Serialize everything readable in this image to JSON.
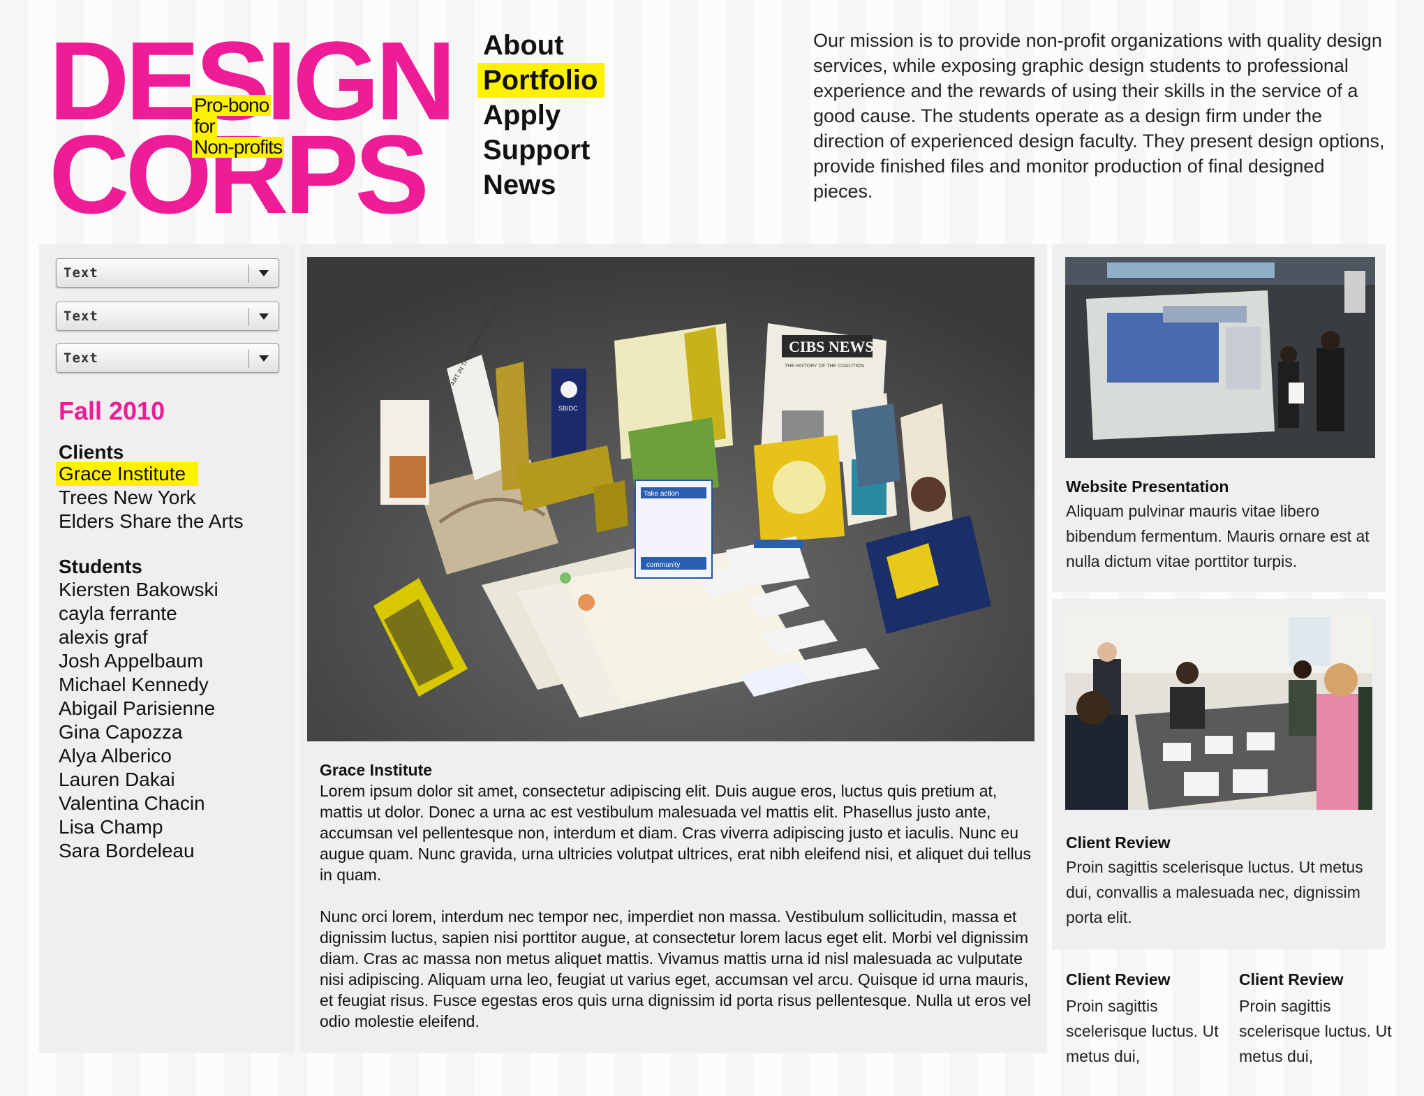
{
  "logo": {
    "line1": "DESIGN",
    "line2": "CORPS",
    "tag_line1": "Pro-bono",
    "tag_line2": "for",
    "tag_line3": "Non-profits"
  },
  "nav": {
    "items": [
      "About",
      "Portfolio",
      "Apply",
      "Support",
      "News"
    ],
    "active": "Portfolio"
  },
  "mission": "Our mission is to provide non-profit organizations with quality design services, while exposing graphic design students to professional experience and the rewards of using their skills in the service of a good cause. The students operate as a design firm under the direction of experienced design faculty. They present design options, provide finished files and monitor production of final designed pieces.",
  "filters": [
    "Text",
    "Text",
    "Text"
  ],
  "sidebar": {
    "term": "Fall 2010",
    "clients_heading": "Clients",
    "clients": [
      "Grace Institute",
      "Trees New York",
      "Elders Share the Arts"
    ],
    "active_client": "Grace Institute",
    "students_heading": "Students",
    "students": [
      "Kiersten Bakowski",
      "cayla ferrante",
      "alexis graf",
      "Josh Appelbaum",
      "Michael Kennedy",
      "Abigail Parisienne",
      "Gina Capozza",
      "Alya Alberico",
      "Lauren Dakai",
      "Valentina Chacin",
      "Lisa Champ",
      "Sara Bordeleau"
    ]
  },
  "feature": {
    "title": "Grace Institute",
    "paragraph1": "Lorem ipsum dolor sit amet, consectetur adipiscing elit. Duis augue eros, luctus quis pretium at, mattis ut dolor. Donec a urna ac est vestibulum malesuada vel mattis elit. Phasellus justo ante, accumsan vel pellentesque non, interdum et diam. Cras viverra adipiscing justo et iaculis. Nunc eu augue quam. Nunc gravida, urna ultricies volutpat ultrices, erat nibh eleifend nisi, et aliquet dui tellus in quam.",
    "paragraph2": "Nunc orci lorem, interdum nec tempor nec, imperdiet non massa. Vestibulum sollicitudin, massa et dignissim luctus, sapien nisi porttitor augue, at consectetur lorem lacus eget elit. Morbi vel dignissim diam. Cras ac massa non metus aliquet mattis. Vivamus mattis urna id nisl malesuada ac vulputate nisi adipiscing. Aliquam urna leo, feugiat ut varius eget, accumsan vel arcu. Quisque id urna mauris, et feugiat risus. Fusce egestas eros quis urna dignissim id porta risus pellentesque. Nulla ut eros vel odio molestie eleifend.",
    "photo_text": {
      "newspaper": "CIBS NEWS",
      "newspaper_sub": "THE HISTORY OF THE COALITION",
      "book": "ART IN THE CONTESTED CITY",
      "card": "Take action",
      "sbidc": "SBIDC",
      "community": "community"
    }
  },
  "right_cards": {
    "top": {
      "title": "Website Presentation",
      "text": "Aliquam pulvinar mauris vitae libero bibendum fermentum. Mauris ornare est at nulla dictum vitae porttitor turpis."
    },
    "middle": {
      "title": "Client Review",
      "text": "Proin sagittis scelerisque luctus. Ut metus dui, convallis a malesuada nec, dignissim porta elit."
    },
    "bottom": [
      {
        "title": "Client Review",
        "text": "Proin sagittis scelerisque luctus. Ut metus dui,"
      },
      {
        "title": "Client Review",
        "text": "Proin sagittis scelerisque luctus. Ut metus dui,"
      }
    ]
  },
  "colors": {
    "brand_magenta": "#ee1c96",
    "highlight_yellow": "#fff200",
    "panel_gray": "#efefef"
  }
}
